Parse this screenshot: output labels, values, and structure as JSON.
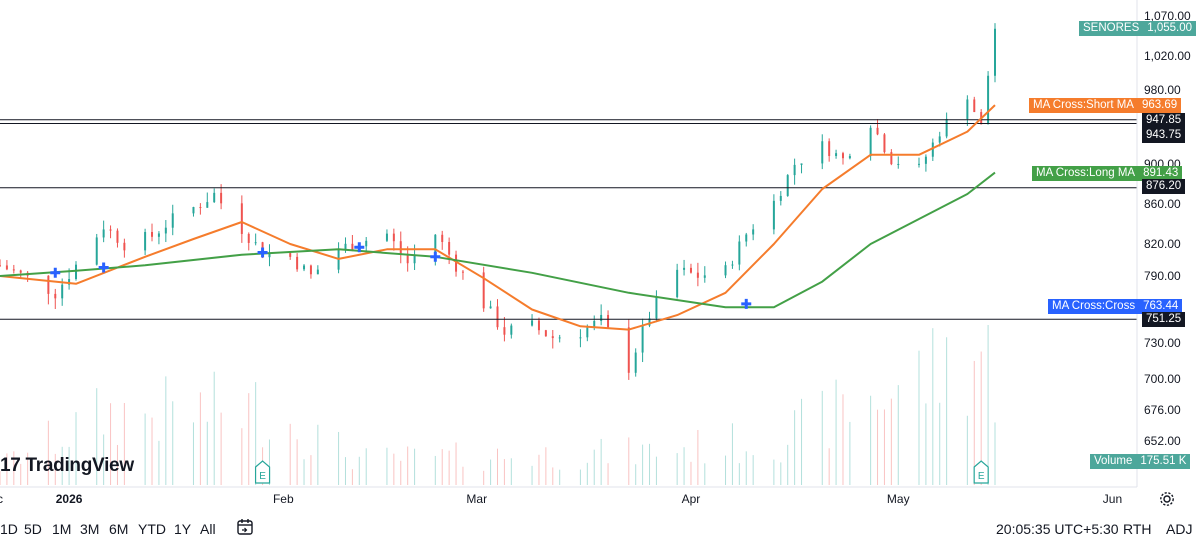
{
  "chart_data": {
    "type": "line",
    "title": "",
    "symbol": "SENORES",
    "last_price": "1,055.00",
    "xlabel": "",
    "ylabel": "",
    "ylim": [
      640,
      1080
    ],
    "x_tick_labels": [
      "c",
      "2026",
      "Feb",
      "Mar",
      "Apr",
      "May",
      "Jun"
    ],
    "y_tick_labels": [
      "1,070.00",
      "1,020.00",
      "980.00",
      "900.00",
      "860.00",
      "820.00",
      "790.00",
      "730.00",
      "700.00",
      "676.00",
      "652.00"
    ],
    "y_tick_values": [
      1070,
      1020,
      980,
      900,
      860,
      820,
      790,
      730,
      700,
      676,
      652
    ],
    "horizontal_lines": [
      {
        "label": "947.85",
        "value": 947.85
      },
      {
        "label": "943.75",
        "value": 943.75
      },
      {
        "label": "876.20",
        "value": 876.2
      },
      {
        "label": "751.25",
        "value": 751.25
      }
    ],
    "indicators": [
      {
        "name": "MA Cross:Short MA",
        "value": "963.69",
        "color": "#f57c2c"
      },
      {
        "name": "MA Cross:Long MA",
        "value": "891.43",
        "color": "#43a047"
      },
      {
        "name": "MA Cross:Cross",
        "value": "763.44",
        "color": "#2962ff"
      },
      {
        "name": "Volume",
        "value": "175.51 K",
        "color": "#4da79b"
      }
    ],
    "price_series": [
      {
        "date": "2025-12-22",
        "close": 800
      },
      {
        "date": "2025-12-26",
        "close": 788
      },
      {
        "date": "2025-12-30",
        "close": 775
      },
      {
        "date": "2026-01-02",
        "close": 800
      },
      {
        "date": "2026-01-06",
        "close": 838
      },
      {
        "date": "2026-01-09",
        "close": 820
      },
      {
        "date": "2026-01-13",
        "close": 828
      },
      {
        "date": "2026-01-16",
        "close": 845
      },
      {
        "date": "2026-01-20",
        "close": 860
      },
      {
        "date": "2026-01-22",
        "close": 870
      },
      {
        "date": "2026-01-26",
        "close": 835
      },
      {
        "date": "2026-01-29",
        "close": 812
      },
      {
        "date": "2026-02-02",
        "close": 808
      },
      {
        "date": "2026-02-05",
        "close": 790
      },
      {
        "date": "2026-02-09",
        "close": 815
      },
      {
        "date": "2026-02-12",
        "close": 822
      },
      {
        "date": "2026-02-16",
        "close": 830
      },
      {
        "date": "2026-02-19",
        "close": 802
      },
      {
        "date": "2026-02-23",
        "close": 830
      },
      {
        "date": "2026-02-26",
        "close": 800
      },
      {
        "date": "2026-03-02",
        "close": 765
      },
      {
        "date": "2026-03-05",
        "close": 740
      },
      {
        "date": "2026-03-09",
        "close": 745
      },
      {
        "date": "2026-03-12",
        "close": 735
      },
      {
        "date": "2026-03-16",
        "close": 740
      },
      {
        "date": "2026-03-19",
        "close": 750
      },
      {
        "date": "2026-03-23",
        "close": 710
      },
      {
        "date": "2026-03-26",
        "close": 755
      },
      {
        "date": "2026-03-30",
        "close": 795
      },
      {
        "date": "2026-04-02",
        "close": 790
      },
      {
        "date": "2026-04-06",
        "close": 795
      },
      {
        "date": "2026-04-09",
        "close": 830
      },
      {
        "date": "2026-04-13",
        "close": 862
      },
      {
        "date": "2026-04-16",
        "close": 900
      },
      {
        "date": "2026-04-20",
        "close": 920
      },
      {
        "date": "2026-04-23",
        "close": 905
      },
      {
        "date": "2026-04-27",
        "close": 945
      },
      {
        "date": "2026-04-30",
        "close": 905
      },
      {
        "date": "2026-05-04",
        "close": 895
      },
      {
        "date": "2026-05-07",
        "close": 935
      },
      {
        "date": "2026-05-11",
        "close": 975
      },
      {
        "date": "2026-05-13",
        "close": 940
      },
      {
        "date": "2026-05-15",
        "close": 1055
      }
    ],
    "series": [
      {
        "name": "MA Cross:Short MA",
        "values": [
          {
            "date": "2025-12-22",
            "value": 790
          },
          {
            "date": "2026-01-02",
            "value": 783
          },
          {
            "date": "2026-01-12",
            "value": 808
          },
          {
            "date": "2026-01-19",
            "value": 825
          },
          {
            "date": "2026-01-26",
            "value": 842
          },
          {
            "date": "2026-02-02",
            "value": 820
          },
          {
            "date": "2026-02-09",
            "value": 806
          },
          {
            "date": "2026-02-16",
            "value": 815
          },
          {
            "date": "2026-02-23",
            "value": 815
          },
          {
            "date": "2026-03-02",
            "value": 788
          },
          {
            "date": "2026-03-09",
            "value": 760
          },
          {
            "date": "2026-03-16",
            "value": 745
          },
          {
            "date": "2026-03-23",
            "value": 742
          },
          {
            "date": "2026-03-30",
            "value": 755
          },
          {
            "date": "2026-04-06",
            "value": 775
          },
          {
            "date": "2026-04-13",
            "value": 820
          },
          {
            "date": "2026-04-20",
            "value": 875
          },
          {
            "date": "2026-04-27",
            "value": 910
          },
          {
            "date": "2026-05-04",
            "value": 910
          },
          {
            "date": "2026-05-11",
            "value": 935
          },
          {
            "date": "2026-05-15",
            "value": 963.69
          }
        ]
      },
      {
        "name": "MA Cross:Long MA",
        "values": [
          {
            "date": "2025-12-22",
            "value": 790
          },
          {
            "date": "2026-01-02",
            "value": 795
          },
          {
            "date": "2026-01-12",
            "value": 800
          },
          {
            "date": "2026-01-26",
            "value": 810
          },
          {
            "date": "2026-02-09",
            "value": 815
          },
          {
            "date": "2026-02-23",
            "value": 808
          },
          {
            "date": "2026-03-09",
            "value": 793
          },
          {
            "date": "2026-03-23",
            "value": 775
          },
          {
            "date": "2026-04-06",
            "value": 762
          },
          {
            "date": "2026-04-13",
            "value": 762
          },
          {
            "date": "2026-04-20",
            "value": 785
          },
          {
            "date": "2026-04-27",
            "value": 820
          },
          {
            "date": "2026-05-04",
            "value": 845
          },
          {
            "date": "2026-05-11",
            "value": 870
          },
          {
            "date": "2026-05-15",
            "value": 891.43
          }
        ]
      }
    ],
    "cross_points": [
      {
        "date": "2025-12-30",
        "value": 793
      },
      {
        "date": "2026-01-06",
        "value": 798
      },
      {
        "date": "2026-01-29",
        "value": 812
      },
      {
        "date": "2026-02-12",
        "value": 817
      },
      {
        "date": "2026-02-23",
        "value": 808
      },
      {
        "date": "2026-04-09",
        "value": 765
      }
    ],
    "volume_series": [
      {
        "date": "2025-12-22",
        "value": 30
      },
      {
        "date": "2026-01-06",
        "value": 110
      },
      {
        "date": "2026-01-29",
        "value": 120
      },
      {
        "date": "2026-02-12",
        "value": 40
      },
      {
        "date": "2026-03-02",
        "value": 45
      },
      {
        "date": "2026-03-23",
        "value": 50
      },
      {
        "date": "2026-04-13",
        "value": 70
      },
      {
        "date": "2026-05-13",
        "value": 210
      },
      {
        "date": "2026-05-15",
        "value": 175.51
      }
    ],
    "event_markers": [
      {
        "date": "2026-01-29",
        "label": "E"
      },
      {
        "date": "2026-05-13",
        "label": "E"
      }
    ],
    "grid": false,
    "legend": "right"
  },
  "toolbar": {
    "ranges": [
      "1D",
      "5D",
      "1M",
      "3M",
      "6M",
      "YTD",
      "1Y",
      "All"
    ],
    "time": "20:05:35 UTC+5:30",
    "session": "RTH",
    "adj": "ADJ"
  },
  "branding": {
    "logo": "TradingView"
  },
  "colors": {
    "up": "#26a69a",
    "down": "#ef5350",
    "short_ma": "#f57c2c",
    "long_ma": "#43a047",
    "cross": "#2962ff"
  }
}
